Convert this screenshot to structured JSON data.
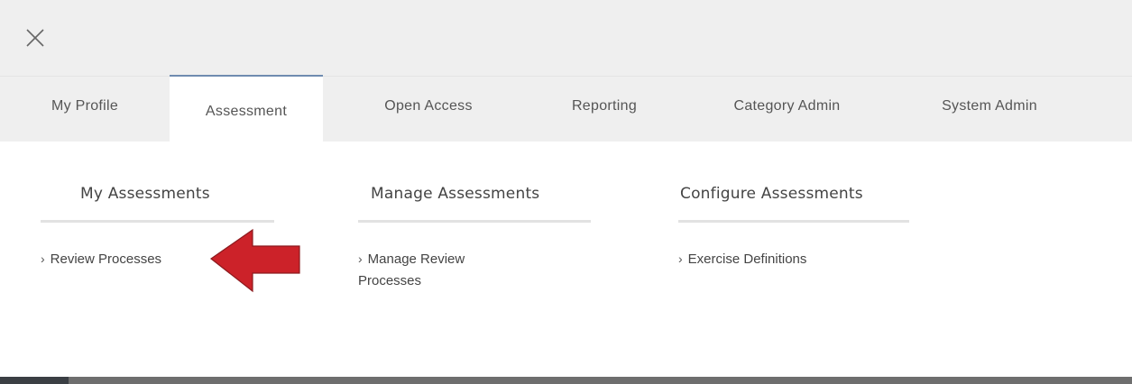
{
  "header": {
    "close_icon": "close-icon"
  },
  "tabs": [
    {
      "label": "My Profile",
      "active": false
    },
    {
      "label": "Assessment",
      "active": true
    },
    {
      "label": "Open Access",
      "active": false
    },
    {
      "label": "Reporting",
      "active": false
    },
    {
      "label": "Category Admin",
      "active": false
    },
    {
      "label": "System Admin",
      "active": false
    }
  ],
  "menu": {
    "columns": [
      {
        "heading": "My Assessments",
        "links": [
          {
            "label": "Review Processes"
          }
        ]
      },
      {
        "heading": "Manage Assessments",
        "links": [
          {
            "label": "Manage Review Processes"
          }
        ]
      },
      {
        "heading": "Configure Assessments",
        "links": [
          {
            "label": "Exercise Definitions"
          }
        ]
      }
    ]
  },
  "annotation": {
    "arrow_color": "#cc2229",
    "points_to": "Review Processes"
  },
  "colors": {
    "background": "#efefef",
    "active_tab_accent": "#6f8bb0",
    "rule": "#e2e2e2"
  }
}
